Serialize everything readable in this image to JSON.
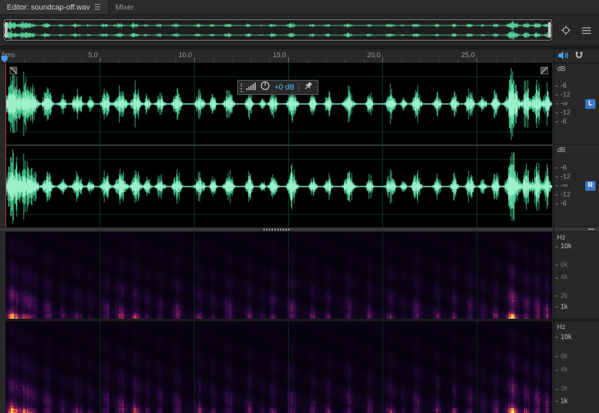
{
  "tabs": {
    "editor": "Editor: soundcap-off.wav",
    "mixer": "Mixer"
  },
  "timeline": {
    "unit_label": "hms",
    "ticks": [
      "5,0",
      "10,0",
      "15,0",
      "20,0",
      "25,0"
    ],
    "tick_seconds": [
      5,
      10,
      15,
      20,
      25
    ],
    "visible_seconds": 29
  },
  "hud": {
    "gain_label": "+0 dB"
  },
  "channels": [
    {
      "label": "L"
    },
    {
      "label": "R"
    }
  ],
  "db_scale": {
    "title": "dB",
    "labels": [
      "-6",
      "-12",
      "-∞",
      "-12",
      "-6"
    ]
  },
  "hz_scale": {
    "title": "Hz",
    "labels": [
      {
        "text": "10k",
        "pos": 17,
        "dim": false
      },
      {
        "text": "6k",
        "pos": 38,
        "dim": true
      },
      {
        "text": "4k",
        "pos": 53,
        "dim": true
      },
      {
        "text": "2k",
        "pos": 74,
        "dim": true
      },
      {
        "text": "1k",
        "pos": 87,
        "dim": false
      }
    ]
  },
  "icons": {
    "tab_menu": "☰"
  },
  "colors": {
    "waveform": "#4ade96",
    "waveform_core": "#a6f5d2",
    "grid_green": "#1c6a3c",
    "accent_blue": "#4aa3f0",
    "badge_blue": "#3c78c8",
    "playhead_red": "#c23a32",
    "hud_gain_text": "#49c1f5"
  }
}
